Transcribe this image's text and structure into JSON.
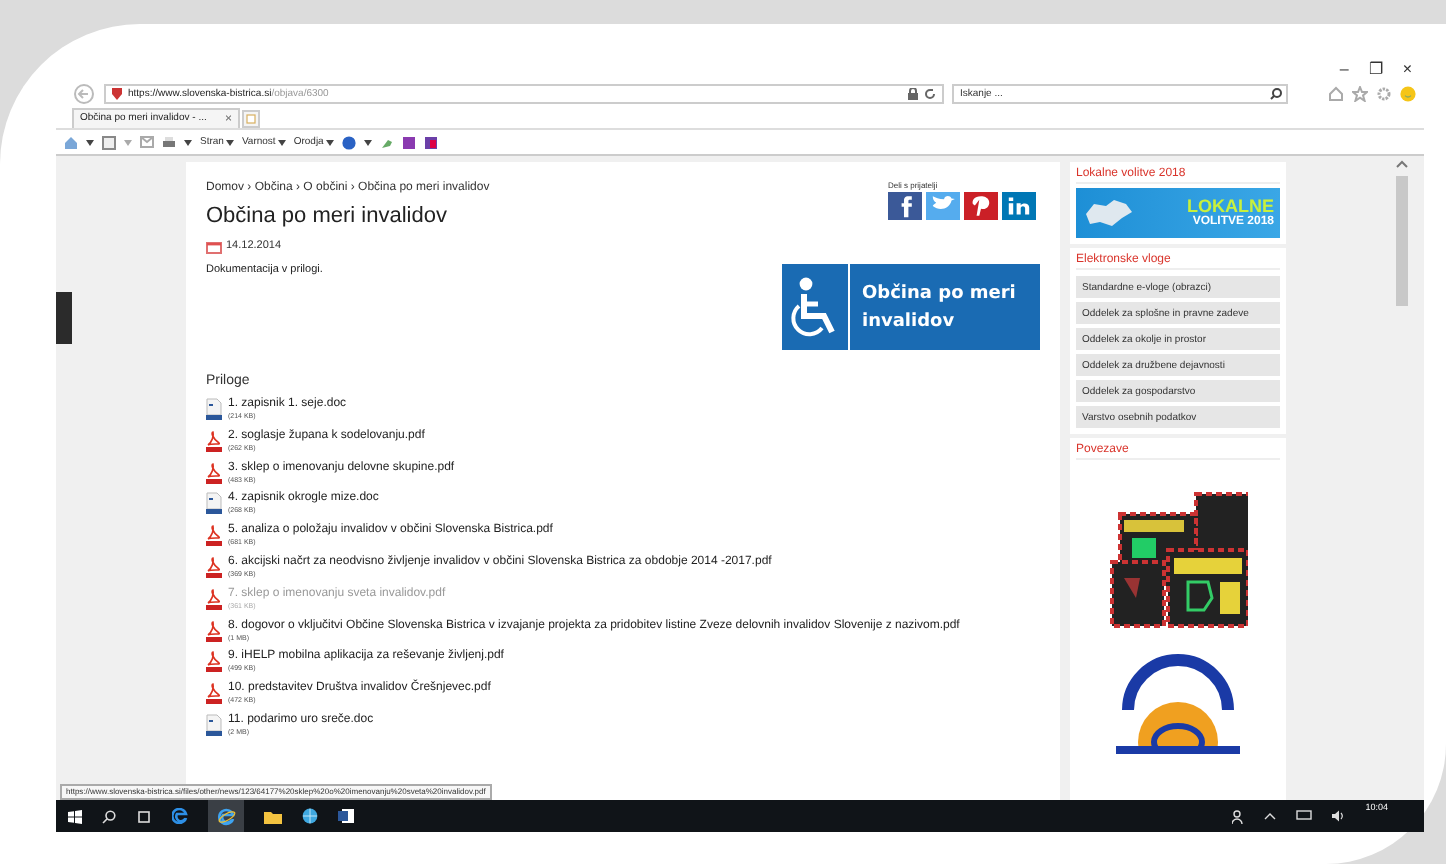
{
  "browser": {
    "window_controls": [
      "–",
      "❐",
      "×"
    ],
    "address_host": "https://www.slovenska-bistrica.si",
    "address_path": "/objava/6300",
    "search_placeholder": "Iskanje ...",
    "tab": {
      "title": "Občina po meri invalidov - ...",
      "close": "×"
    },
    "menus": [
      "Stran",
      "Varnost",
      "Orodja"
    ]
  },
  "page": {
    "breadcrumb": "Domov › Občina › O občini › Občina po meri invalidov",
    "share_label": "Deli s prijatelji",
    "title": "Občina po meri invalidov",
    "date": "14.12.2014",
    "intro": "Dokumentacija v prilogi.",
    "banner_text": "Občina po meri invalidov",
    "attachments_heading": "Priloge",
    "attachments": [
      {
        "kind": "doc",
        "name": "1. zapisnik 1. seje.doc",
        "size": "(214 KB)",
        "visited": false
      },
      {
        "kind": "pdf",
        "name": "2. soglasje župana k sodelovanju.pdf",
        "size": "(262 KB)",
        "visited": false
      },
      {
        "kind": "pdf",
        "name": "3. sklep o imenovanju delovne skupine.pdf",
        "size": "(483 KB)",
        "visited": false
      },
      {
        "kind": "doc",
        "name": "4. zapisnik okrogle mize.doc",
        "size": "(268 KB)",
        "visited": false
      },
      {
        "kind": "pdf",
        "name": "5. analiza o položaju invalidov v občini Slovenska Bistrica.pdf",
        "size": "(681 KB)",
        "visited": false
      },
      {
        "kind": "pdf",
        "name": "6. akcijski načrt za neodvisno življenje invalidov v občini Slovenska Bistrica za obdobje 2014 -2017.pdf",
        "size": "(369 KB)",
        "visited": false
      },
      {
        "kind": "pdf",
        "name": "7. sklep o imenovanju sveta invalidov.pdf",
        "size": "(361 KB)",
        "visited": true
      },
      {
        "kind": "pdf",
        "name": "8. dogovor o vključitvi Občine Slovenska Bistrica v izvajanje projekta za pridobitev listine Zveze delovnih invalidov Slovenije z nazivom.pdf",
        "size": "(1 MB)",
        "visited": false
      },
      {
        "kind": "pdf",
        "name": "9. iHELP mobilna aplikacija za reševanje življenj.pdf",
        "size": "(499 KB)",
        "visited": false
      },
      {
        "kind": "pdf",
        "name": "10. predstavitev Društva invalidov Črešnjevec.pdf",
        "size": "(472 KB)",
        "visited": false
      },
      {
        "kind": "doc",
        "name": "11. podarimo uro sreče.doc",
        "size": "(2 MB)",
        "visited": false
      }
    ]
  },
  "sidebar": {
    "elections": {
      "heading": "Lokalne volitve 2018",
      "banner_line_1": "LOKALNE",
      "banner_line_2": "VOLITVE 2018"
    },
    "e_forms": {
      "heading": "Elektronske vloge",
      "items": [
        "Standardne e-vloge (obrazci)",
        "Oddelek za splošne in pravne zadeve",
        "Oddelek za okolje in prostor",
        "Oddelek za družbene dejavnosti",
        "Oddelek za gospodarstvo",
        "Varstvo osebnih podatkov"
      ]
    },
    "links": {
      "heading": "Povezave"
    }
  },
  "status_url": "https://www.slovenska-bistrica.si/files/other/news/123/64177%20sklep%20o%20imenovanju%20sveta%20invalidov.pdf",
  "taskbar": {
    "clock": "10:04"
  }
}
